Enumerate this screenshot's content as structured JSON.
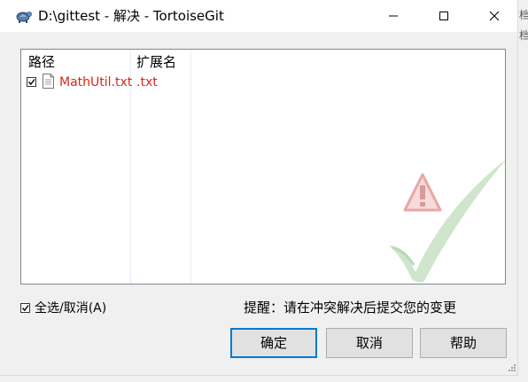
{
  "window": {
    "title": "D:\\gittest - 解决 - TortoiseGit",
    "icon": "tortoisegit-app-icon",
    "controls": [
      "minimize-icon",
      "maximize-icon",
      "close-icon"
    ]
  },
  "edge_text": [
    "档",
    "档"
  ],
  "list": {
    "columns": [
      "路径",
      "扩展名"
    ],
    "rows": [
      {
        "checked": true,
        "path": "MathUtil.txt",
        "extension": ".txt",
        "icon": "text-file-icon",
        "color": "#d9261c"
      }
    ],
    "watermark_icon": "warning-checkmark-icon"
  },
  "footer": {
    "select_all": {
      "label": "全选/取消(A)",
      "checked": true
    },
    "hint": "提醒：请在冲突解决后提交您的变更"
  },
  "buttons": {
    "ok": "确定",
    "cancel": "取消",
    "help": "帮助"
  },
  "colors": {
    "default_button_border": "#0078d7",
    "conflict_text": "#d9261c"
  }
}
